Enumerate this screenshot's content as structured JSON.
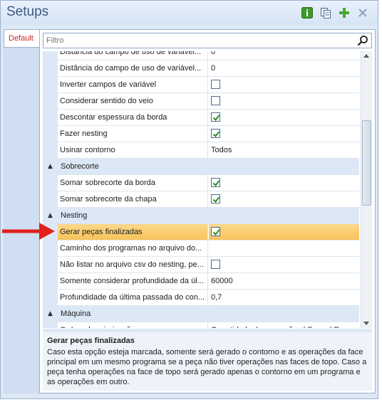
{
  "window": {
    "title": "Setups"
  },
  "toolbar": {
    "icons": [
      "info-icon",
      "copy-icon",
      "add-icon",
      "close-icon"
    ],
    "accent": "#3b5a82"
  },
  "tabs": [
    {
      "label": "Default",
      "color": "#c0282c"
    }
  ],
  "filter": {
    "placeholder": "Filtro",
    "value": ""
  },
  "grid": {
    "rows": [
      {
        "type": "prop",
        "name": "Distância do campo de uso de variável...",
        "value": "0",
        "kind": "text"
      },
      {
        "type": "prop",
        "name": "Distância do campo de uso de variável...",
        "value": "0",
        "kind": "text"
      },
      {
        "type": "prop",
        "name": "Inverter campos de variável",
        "value": "",
        "kind": "check",
        "checked": false
      },
      {
        "type": "prop",
        "name": "Considerar sentido do veio",
        "value": "",
        "kind": "check",
        "checked": false
      },
      {
        "type": "prop",
        "name": "Descontar espessura da borda",
        "value": "",
        "kind": "check",
        "checked": true
      },
      {
        "type": "prop",
        "name": "Fazer nesting",
        "value": "",
        "kind": "check",
        "checked": true
      },
      {
        "type": "prop",
        "name": "Usinar contorno",
        "value": "Todos",
        "kind": "text"
      },
      {
        "type": "cat",
        "name": "Sobrecorte"
      },
      {
        "type": "prop",
        "name": "Somar sobrecorte da borda",
        "value": "",
        "kind": "check",
        "checked": true
      },
      {
        "type": "prop",
        "name": "Somar sobrecorte da chapa",
        "value": "",
        "kind": "check",
        "checked": true
      },
      {
        "type": "cat",
        "name": "Nesting"
      },
      {
        "type": "prop",
        "name": "Gerar peças finalizadas",
        "value": "",
        "kind": "check",
        "checked": true,
        "selected": true
      },
      {
        "type": "prop",
        "name": "Caminho dos programas no arquivo do...",
        "value": "",
        "kind": "text"
      },
      {
        "type": "prop",
        "name": "Não listar no arquivo csv do nesting, pe...",
        "value": "",
        "kind": "check",
        "checked": false
      },
      {
        "type": "prop",
        "name": "Somente considerar profundidade da úl...",
        "value": "60000",
        "kind": "text"
      },
      {
        "type": "prop",
        "name": "Profundidade da última passada do con...",
        "value": "0,7",
        "kind": "text"
      },
      {
        "type": "cat",
        "name": "Máquina"
      },
      {
        "type": "prop",
        "name": "Ordem de priorização",
        "value": "Quantidade de operações | Furos | Rasgo",
        "kind": "text"
      }
    ]
  },
  "description": {
    "title": "Gerar peças finalizadas",
    "text": "Caso esta opção esteja marcada, somente será gerado o contorno e as operações da face principal em um mesmo programa se a peça não tiver operações nas faces de topo. Caso a peça tenha operações na face de topo será gerado apenas o contorno em um programa e as operações em outro."
  },
  "annotation": {
    "arrow_color": "#e0201c"
  }
}
